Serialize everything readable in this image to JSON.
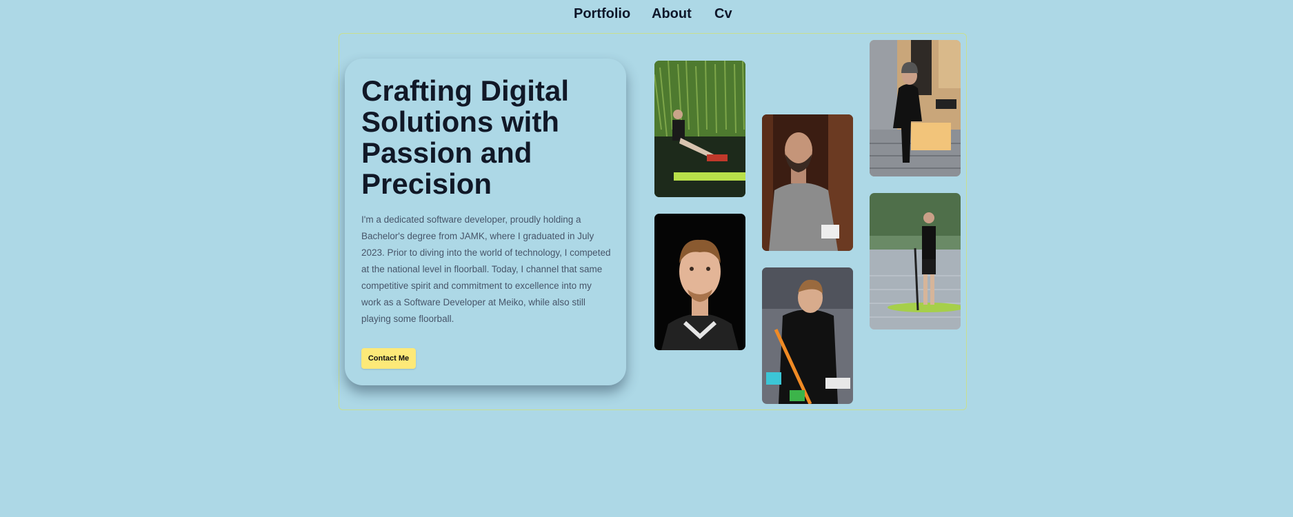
{
  "nav": {
    "items": [
      {
        "label": "Portfolio"
      },
      {
        "label": "About"
      },
      {
        "label": "Cv"
      }
    ]
  },
  "hero": {
    "title": "Crafting Digital Solutions with Passion and Precision",
    "description": "I'm a dedicated software developer, proudly holding a Bachelor's degree from JAMK, where I graduated in July 2023. Prior to diving into the world of technology, I competed at the national level in floorball. Today, I channel that same competitive spirit and commitment to excellence into my work as a Software Developer at Meiko, while also still playing some floorball.",
    "contact_label": "Contact Me"
  },
  "gallery": {
    "photos": [
      {
        "subject": "person sitting by lake on paddleboard"
      },
      {
        "subject": "portrait headshot on black background"
      },
      {
        "subject": "man in grey sweater sitting on wooden bench"
      },
      {
        "subject": "floorball player in black jersey"
      },
      {
        "subject": "man in hoodie sitting on stairs"
      },
      {
        "subject": "person standing on paddleboard on lake"
      }
    ]
  },
  "colors": {
    "background": "#add8e6",
    "accent_button": "#fde978",
    "frame_border": "#c9df8f",
    "heading": "#111827",
    "body_text": "#475569"
  }
}
